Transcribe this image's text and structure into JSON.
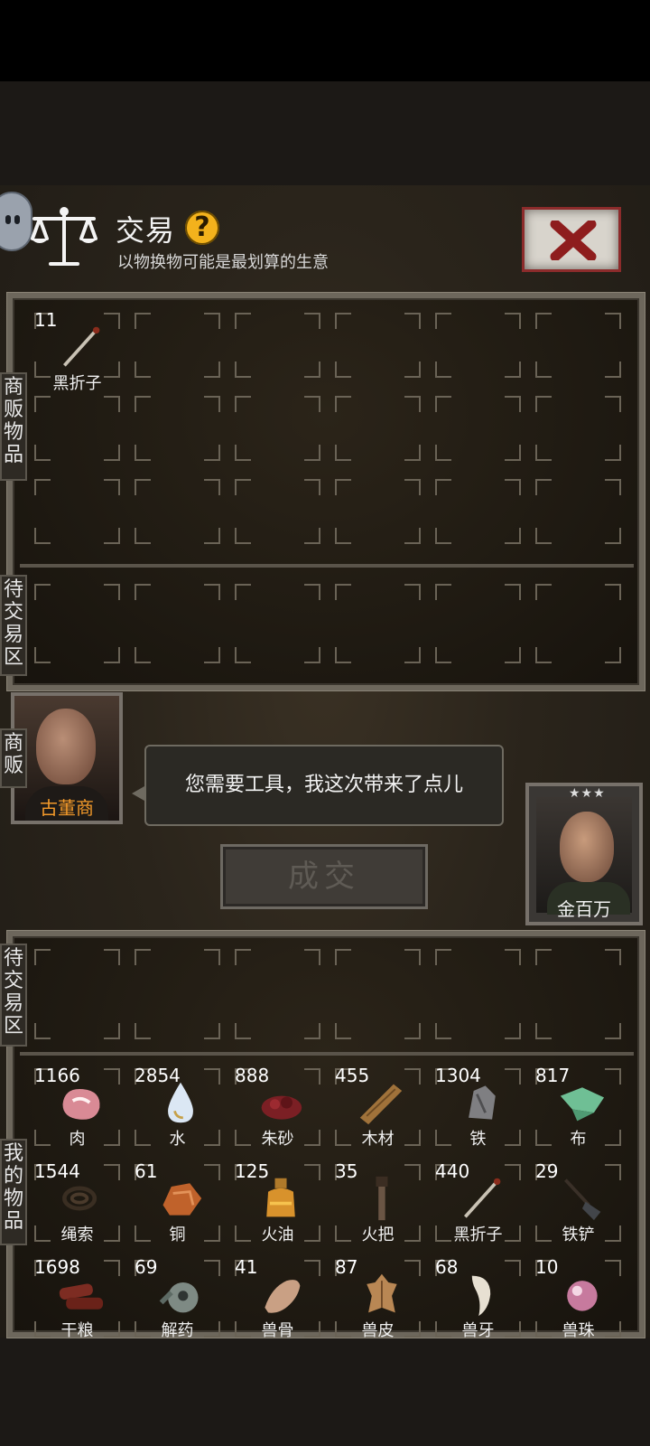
{
  "header": {
    "title": "交易",
    "help": "?",
    "subtitle": "以物换物可能是最划算的生意"
  },
  "zones": {
    "merchant_goods_label": "商\n贩\n物\n品",
    "merchant_pending_label": "待\n交\n易\n区",
    "merchant_label": "商\n贩",
    "my_pending_label": "待\n交\n易\n区",
    "my_goods_label": "我\n的\n物\n品"
  },
  "merchant_goods": [
    {
      "count": "11",
      "name": "黑折子",
      "icon": "fire-starter-icon"
    }
  ],
  "merchant": {
    "name": "古董商",
    "dialog": "您需要工具，我这次带来了点儿"
  },
  "deal_button": "成交",
  "player": {
    "name": "金百万",
    "stars": "★★★"
  },
  "my_goods": [
    {
      "count": "1166",
      "name": "肉",
      "icon": "meat-icon"
    },
    {
      "count": "2854",
      "name": "水",
      "icon": "water-drop-icon"
    },
    {
      "count": "888",
      "name": "朱砂",
      "icon": "cinnabar-icon"
    },
    {
      "count": "455",
      "name": "木材",
      "icon": "wood-plank-icon"
    },
    {
      "count": "1304",
      "name": "铁",
      "icon": "iron-ore-icon"
    },
    {
      "count": "817",
      "name": "布",
      "icon": "cloth-icon"
    },
    {
      "count": "1544",
      "name": "绳索",
      "icon": "rope-icon"
    },
    {
      "count": "61",
      "name": "铜",
      "icon": "copper-ore-icon"
    },
    {
      "count": "125",
      "name": "火油",
      "icon": "oil-bottle-icon"
    },
    {
      "count": "35",
      "name": "火把",
      "icon": "torch-icon"
    },
    {
      "count": "440",
      "name": "黑折子",
      "icon": "fire-starter-icon"
    },
    {
      "count": "29",
      "name": "铁铲",
      "icon": "shovel-icon"
    },
    {
      "count": "1698",
      "name": "干粮",
      "icon": "dry-food-icon"
    },
    {
      "count": "69",
      "name": "解药",
      "icon": "antidote-icon"
    },
    {
      "count": "41",
      "name": "兽骨",
      "icon": "bone-icon"
    },
    {
      "count": "87",
      "name": "兽皮",
      "icon": "hide-icon"
    },
    {
      "count": "68",
      "name": "兽牙",
      "icon": "fang-icon"
    },
    {
      "count": "10",
      "name": "兽珠",
      "icon": "pearl-icon"
    }
  ]
}
